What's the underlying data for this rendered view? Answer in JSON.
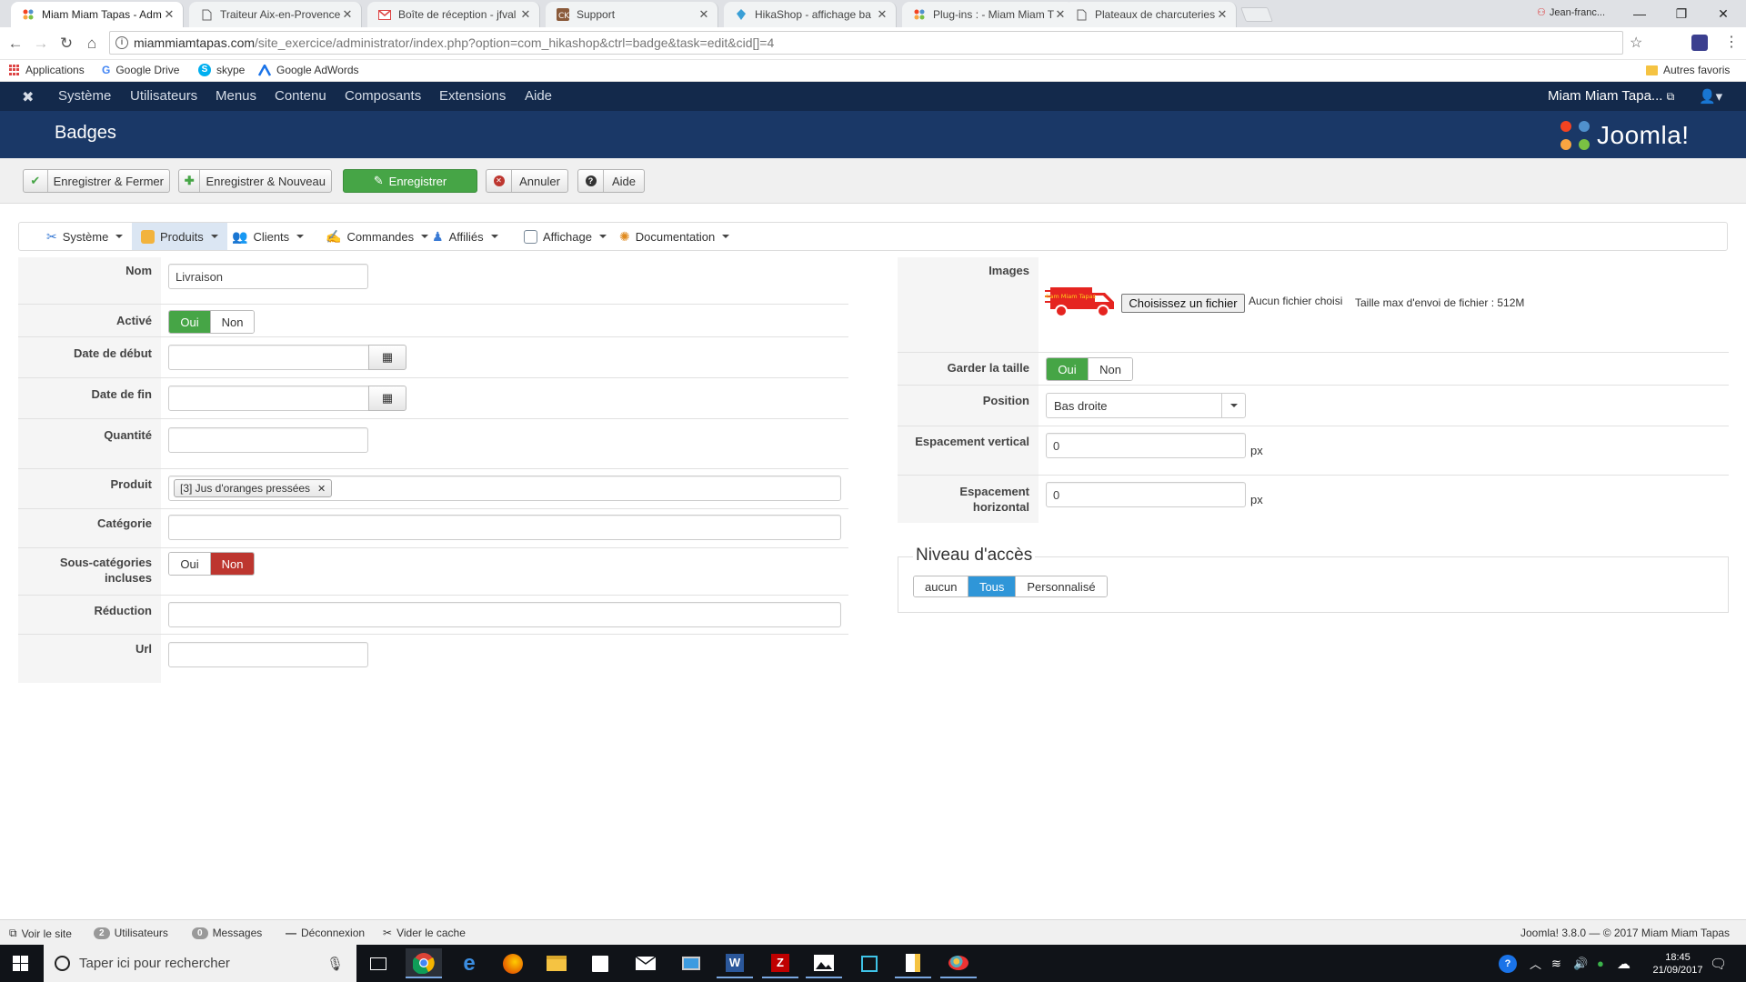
{
  "browser": {
    "tabs": [
      {
        "title": "Miam Miam Tapas - Adm",
        "active": true
      },
      {
        "title": "Traiteur Aix-en-Provence",
        "active": false
      },
      {
        "title": "Boîte de réception - jfval",
        "active": false
      },
      {
        "title": "Support",
        "active": false
      },
      {
        "title": "HikaShop - affichage ba",
        "active": false
      },
      {
        "title": "Plug-ins : - Miam Miam T",
        "active": false
      },
      {
        "title": "Plateaux de charcuteries",
        "active": false
      }
    ],
    "profile_name": "Jean-franc...",
    "url_host": "miammiamtapas.com",
    "url_path": "/site_exercice/administrator/index.php?option=com_hikashop&ctrl=badge&task=edit&cid[]=4",
    "bookmarks": [
      "Applications",
      "Google Drive",
      "skype",
      "Google AdWords"
    ],
    "other_bookmarks": "Autres favoris"
  },
  "joomla": {
    "menu": [
      "Système",
      "Utilisateurs",
      "Menus",
      "Contenu",
      "Composants",
      "Extensions",
      "Aide"
    ],
    "site_name": "Miam Miam Tapa...",
    "page_title": "Badges",
    "logo_text": "Joomla!",
    "toolbar": {
      "save_close": "Enregistrer & Fermer",
      "save_new": "Enregistrer & Nouveau",
      "save": "Enregistrer",
      "cancel": "Annuler",
      "help": "Aide"
    },
    "hika_menu": [
      "Système",
      "Produits",
      "Clients",
      "Commandes",
      "Affiliés",
      "Affichage",
      "Documentation"
    ],
    "form": {
      "name_label": "Nom",
      "name_value": "Livraison",
      "active_label": "Activé",
      "yes": "Oui",
      "no": "Non",
      "start_label": "Date de début",
      "end_label": "Date de fin",
      "quantity_label": "Quantité",
      "product_label": "Produit",
      "product_tag": "[3] Jus d'oranges pressées",
      "category_label": "Catégorie",
      "subcat_label_1": "Sous-catégories",
      "subcat_label_2": "incluses",
      "discount_label": "Réduction",
      "url_label": "Url"
    },
    "right": {
      "images_label": "Images",
      "choose_file": "Choisissez un fichier",
      "no_file": "Aucun fichier choisi",
      "max_size": "Taille max d'envoi de fichier : 512M",
      "keep_size_label": "Garder la taille",
      "position_label": "Position",
      "position_value": "Bas droite",
      "vspace_label": "Espacement vertical",
      "vspace_value": "0",
      "hspace_label_1": "Espacement",
      "hspace_label_2": "horizontal",
      "hspace_value": "0",
      "unit": "px",
      "access_legend": "Niveau d'accès",
      "access_none": "aucun",
      "access_all": "Tous",
      "access_custom": "Personnalisé",
      "badge_text": "Miam Miam Tapas"
    },
    "status": {
      "view_site": "Voir le site",
      "users_count": "2",
      "users_label": "Utilisateurs",
      "messages_count": "0",
      "messages_label": "Messages",
      "logout": "Déconnexion",
      "clear_cache": "Vider le cache",
      "version": "Joomla! 3.8.0  —  © 2017 Miam Miam Tapas"
    }
  },
  "taskbar": {
    "search_placeholder": "Taper ici pour rechercher",
    "time": "18:45",
    "date": "21/09/2017"
  },
  "colors": {
    "joomla_nav": "#13294b",
    "joomla_header": "#1a3867",
    "green": "#46a546",
    "red": "#bd362f",
    "blue": "#2f96d8"
  }
}
